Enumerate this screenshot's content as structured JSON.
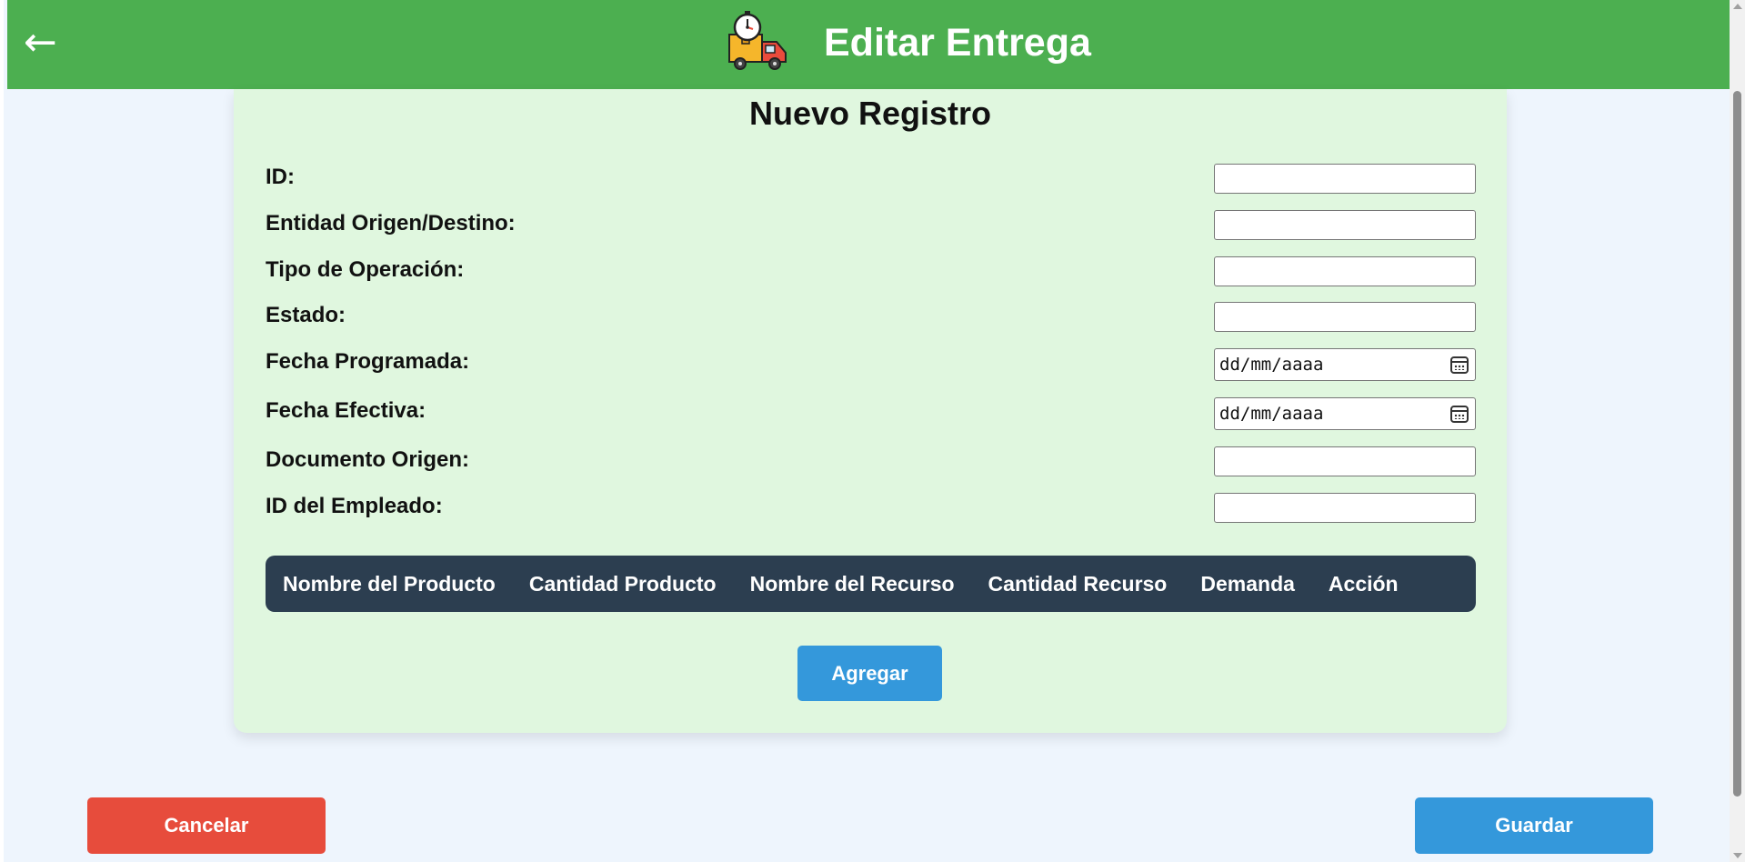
{
  "header": {
    "back_arrow": "←",
    "title": "Editar Entrega",
    "logo_icon": "delivery-truck-clock-icon",
    "background": "#4caf50"
  },
  "form": {
    "title": "Nuevo Registro",
    "fields": [
      {
        "label": "ID:",
        "type": "text",
        "value": ""
      },
      {
        "label": "Entidad Origen/Destino:",
        "type": "text",
        "value": ""
      },
      {
        "label": "Tipo de Operación:",
        "type": "text",
        "value": ""
      },
      {
        "label": "Estado:",
        "type": "text",
        "value": ""
      },
      {
        "label": "Fecha Programada:",
        "type": "date",
        "placeholder": "dd/mm/aaaa"
      },
      {
        "label": "Fecha Efectiva:",
        "type": "date",
        "placeholder": "dd/mm/aaaa"
      },
      {
        "label": "Documento Origen:",
        "type": "text",
        "value": ""
      },
      {
        "label": "ID del Empleado:",
        "type": "text",
        "value": ""
      }
    ]
  },
  "table": {
    "columns": [
      "Nombre del Producto",
      "Cantidad Producto",
      "Nombre del Recurso",
      "Cantidad Recurso",
      "Demanda",
      "Acción"
    ],
    "rows": []
  },
  "buttons": {
    "add_label": "Agregar",
    "cancel_label": "Cancelar",
    "save_label": "Guardar"
  },
  "colors": {
    "primary": "#3498db",
    "danger": "#e74c3c",
    "card_bg": "#e0f7df",
    "table_header": "#2c3e50"
  }
}
